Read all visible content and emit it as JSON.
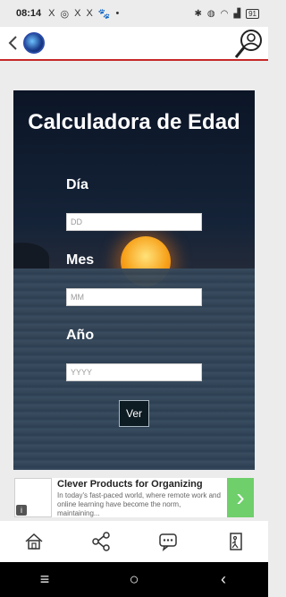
{
  "status_bar": {
    "time": "08:14",
    "notifications": [
      "X",
      "◎",
      "X",
      "X",
      "🐾",
      "•"
    ],
    "battery": "91"
  },
  "app_bar": {
    "back_icon": "chevron-left-icon",
    "logo_icon": "globe-logo-icon",
    "search_icon": "person-search-icon"
  },
  "card": {
    "title": "Calculadora de Edad",
    "fields": [
      {
        "label": "Día",
        "placeholder": "DD",
        "value": ""
      },
      {
        "label": "Mes",
        "placeholder": "MM",
        "value": ""
      },
      {
        "label": "Año",
        "placeholder": "YYYY",
        "value": ""
      }
    ],
    "submit_label": "Ver"
  },
  "ad": {
    "title": "Clever Products for Organizing",
    "description": "In today's fast-paced world, where remote work and online learning have become the norm, maintaining...",
    "info_icon": "info-icon",
    "arrow": "›",
    "accent_color": "#6fcf6b"
  },
  "bottom_nav": {
    "items": [
      "home-icon",
      "share-icon",
      "chat-icon",
      "exit-icon"
    ]
  },
  "system_nav": {
    "recents": "≡",
    "home": "○",
    "back": "‹"
  },
  "colors": {
    "appbar_border": "#c62828",
    "button_bg": "#0d1b22"
  }
}
